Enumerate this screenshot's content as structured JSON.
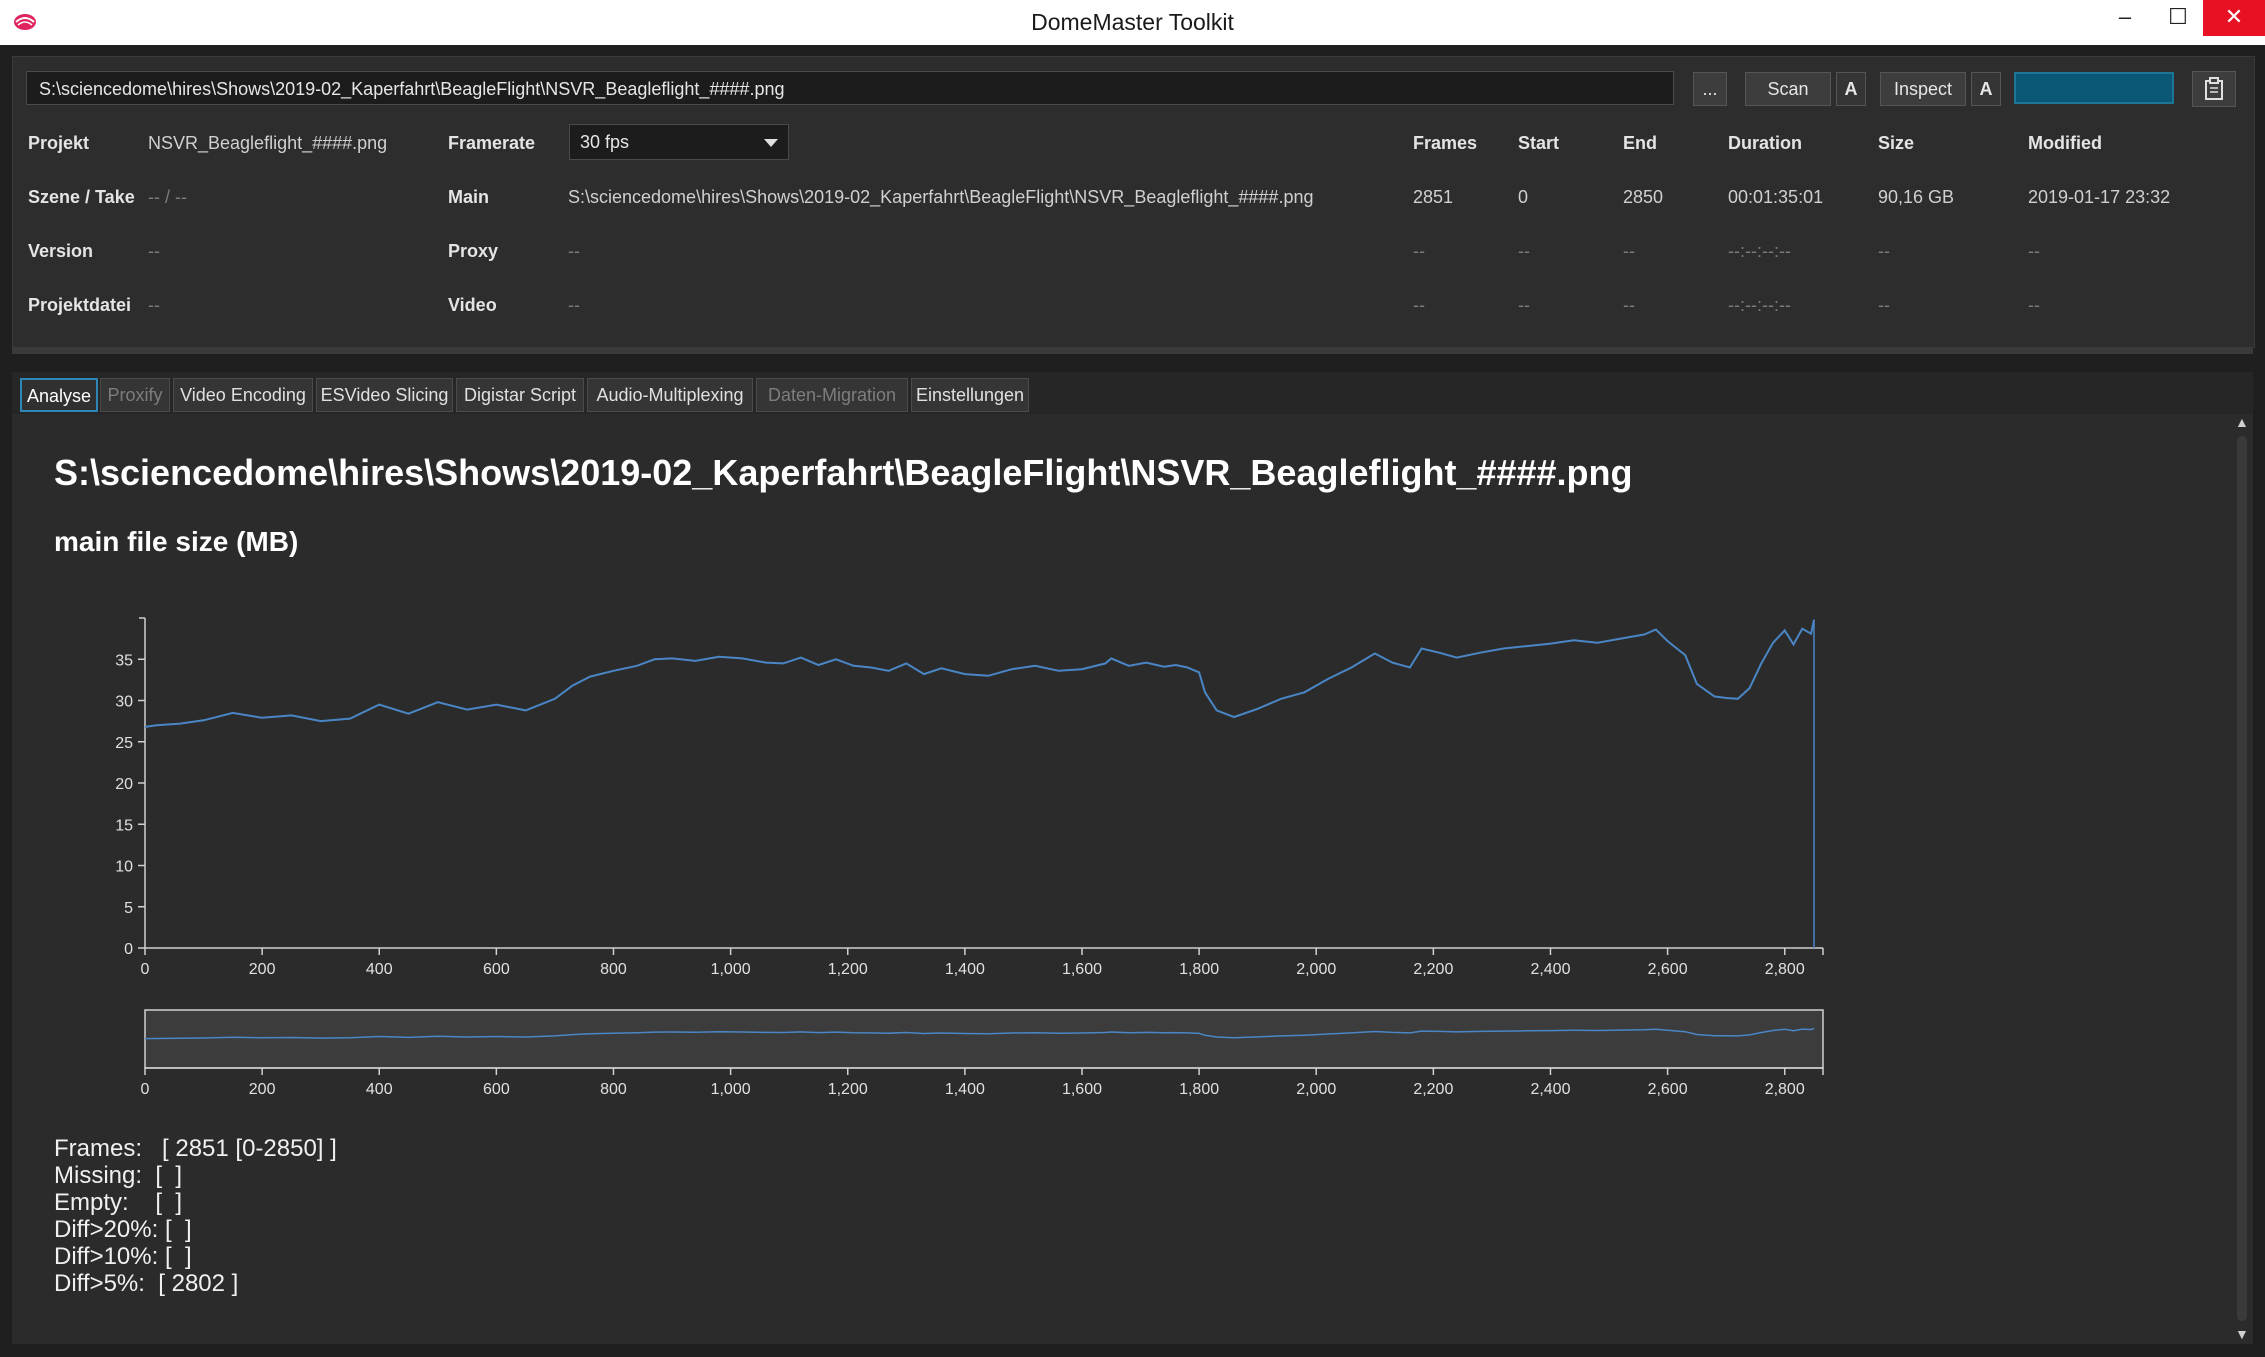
{
  "window": {
    "title": "DomeMaster Toolkit",
    "minimize": "–",
    "maximize": "☐",
    "close": "✕"
  },
  "toolbar": {
    "path": "S:\\sciencedome\\hires\\Shows\\2019-02_Kaperfahrt\\BeagleFlight\\NSVR_Beagleflight_####.png",
    "browse": "...",
    "scan": "Scan",
    "scan_auto": "A",
    "inspect": "Inspect",
    "inspect_auto": "A",
    "progress": 1.0,
    "clipboard_icon": "clipboard-icon"
  },
  "info": {
    "labels": {
      "projekt": "Projekt",
      "szene": "Szene / Take",
      "version": "Version",
      "projektdatei": "Projektdatei",
      "framerate": "Framerate",
      "main": "Main",
      "proxy": "Proxy",
      "video": "Video"
    },
    "projekt": "NSVR_Beagleflight_####.png",
    "szene": "-- / --",
    "version": "--",
    "projektdatei": "--",
    "framerate": "30 fps",
    "main": "S:\\sciencedome\\hires\\Shows\\2019-02_Kaperfahrt\\BeagleFlight\\NSVR_Beagleflight_####.png",
    "proxy": "--",
    "video": "--",
    "columns": [
      "Frames",
      "Start",
      "End",
      "Duration",
      "Size",
      "Modified"
    ],
    "rows": [
      [
        "2851",
        "0",
        "2850",
        "00:01:35:01",
        "90,16 GB",
        "2019-01-17  23:32"
      ],
      [
        "--",
        "--",
        "--",
        "--:--:--:--",
        "--",
        "--"
      ],
      [
        "--",
        "--",
        "--",
        "--:--:--:--",
        "--",
        "--"
      ]
    ]
  },
  "tabs": [
    {
      "label": "Analyse",
      "state": "active"
    },
    {
      "label": "Proxify",
      "state": "disabled"
    },
    {
      "label": "Video Encoding",
      "state": "normal"
    },
    {
      "label": "ESVideo Slicing",
      "state": "normal"
    },
    {
      "label": "Digistar Script",
      "state": "normal"
    },
    {
      "label": "Audio-Multiplexing",
      "state": "normal"
    },
    {
      "label": "Daten-Migration",
      "state": "disabled"
    },
    {
      "label": "Einstellungen",
      "state": "normal"
    }
  ],
  "analyse": {
    "heading": "S:\\sciencedome\\hires\\Shows\\2019-02_Kaperfahrt\\BeagleFlight\\NSVR_Beagleflight_####.png",
    "chart_title": "main file size (MB)",
    "stats": [
      "Frames:   [ 2851 [0-2850] ]",
      "Missing:  [  ]",
      "Empty:    [  ]",
      "Diff>20%: [  ]",
      "Diff>10%: [  ]",
      "Diff>5%:  [ 2802 ]"
    ]
  },
  "chart_data": {
    "type": "line",
    "title": "main file size (MB)",
    "xlabel": "",
    "ylabel": "",
    "xlim": [
      0,
      2850
    ],
    "ylim": [
      0,
      40
    ],
    "yticks": [
      0,
      5,
      10,
      15,
      20,
      25,
      30,
      35
    ],
    "xticks": [
      0,
      200,
      400,
      600,
      800,
      1000,
      1200,
      1400,
      1600,
      1800,
      2000,
      2200,
      2400,
      2600,
      2800
    ],
    "xtick_labels": [
      "0",
      "200",
      "400",
      "600",
      "800",
      "1,000",
      "1,200",
      "1,400",
      "1,600",
      "1,800",
      "2,000",
      "2,200",
      "2,400",
      "2,600",
      "2,800"
    ],
    "grid": false,
    "line_color": "#4a86c5",
    "overview": true,
    "x": [
      0,
      20,
      60,
      100,
      150,
      200,
      250,
      300,
      350,
      400,
      450,
      500,
      550,
      600,
      650,
      700,
      730,
      760,
      800,
      840,
      870,
      900,
      940,
      980,
      1020,
      1060,
      1090,
      1120,
      1150,
      1180,
      1210,
      1240,
      1270,
      1300,
      1330,
      1360,
      1400,
      1440,
      1480,
      1520,
      1560,
      1600,
      1640,
      1650,
      1680,
      1710,
      1740,
      1760,
      1780,
      1800,
      1810,
      1830,
      1860,
      1900,
      1940,
      1980,
      2020,
      2060,
      2100,
      2130,
      2160,
      2180,
      2210,
      2240,
      2280,
      2320,
      2360,
      2400,
      2440,
      2480,
      2520,
      2560,
      2580,
      2600,
      2630,
      2650,
      2680,
      2700,
      2720,
      2740,
      2760,
      2780,
      2800,
      2815,
      2830,
      2845,
      2850
    ],
    "y": [
      26.8,
      27.0,
      27.2,
      27.6,
      28.5,
      27.9,
      28.2,
      27.5,
      27.8,
      29.5,
      28.4,
      29.8,
      28.9,
      29.5,
      28.8,
      30.2,
      31.8,
      32.9,
      33.6,
      34.2,
      35.0,
      35.1,
      34.8,
      35.3,
      35.1,
      34.6,
      34.5,
      35.2,
      34.3,
      35.0,
      34.2,
      34.0,
      33.6,
      34.5,
      33.2,
      33.9,
      33.2,
      33.0,
      33.8,
      34.2,
      33.6,
      33.8,
      34.5,
      35.1,
      34.2,
      34.6,
      34.1,
      34.3,
      34.0,
      33.4,
      31.0,
      28.8,
      28.0,
      29.0,
      30.2,
      31.0,
      32.6,
      34.0,
      35.7,
      34.6,
      34.0,
      36.3,
      35.8,
      35.2,
      35.8,
      36.3,
      36.6,
      36.9,
      37.3,
      37.0,
      37.5,
      38.0,
      38.6,
      37.2,
      35.5,
      32.0,
      30.5,
      30.3,
      30.2,
      31.5,
      34.5,
      37.0,
      38.5,
      36.8,
      38.7,
      38.1,
      39.8
    ]
  }
}
